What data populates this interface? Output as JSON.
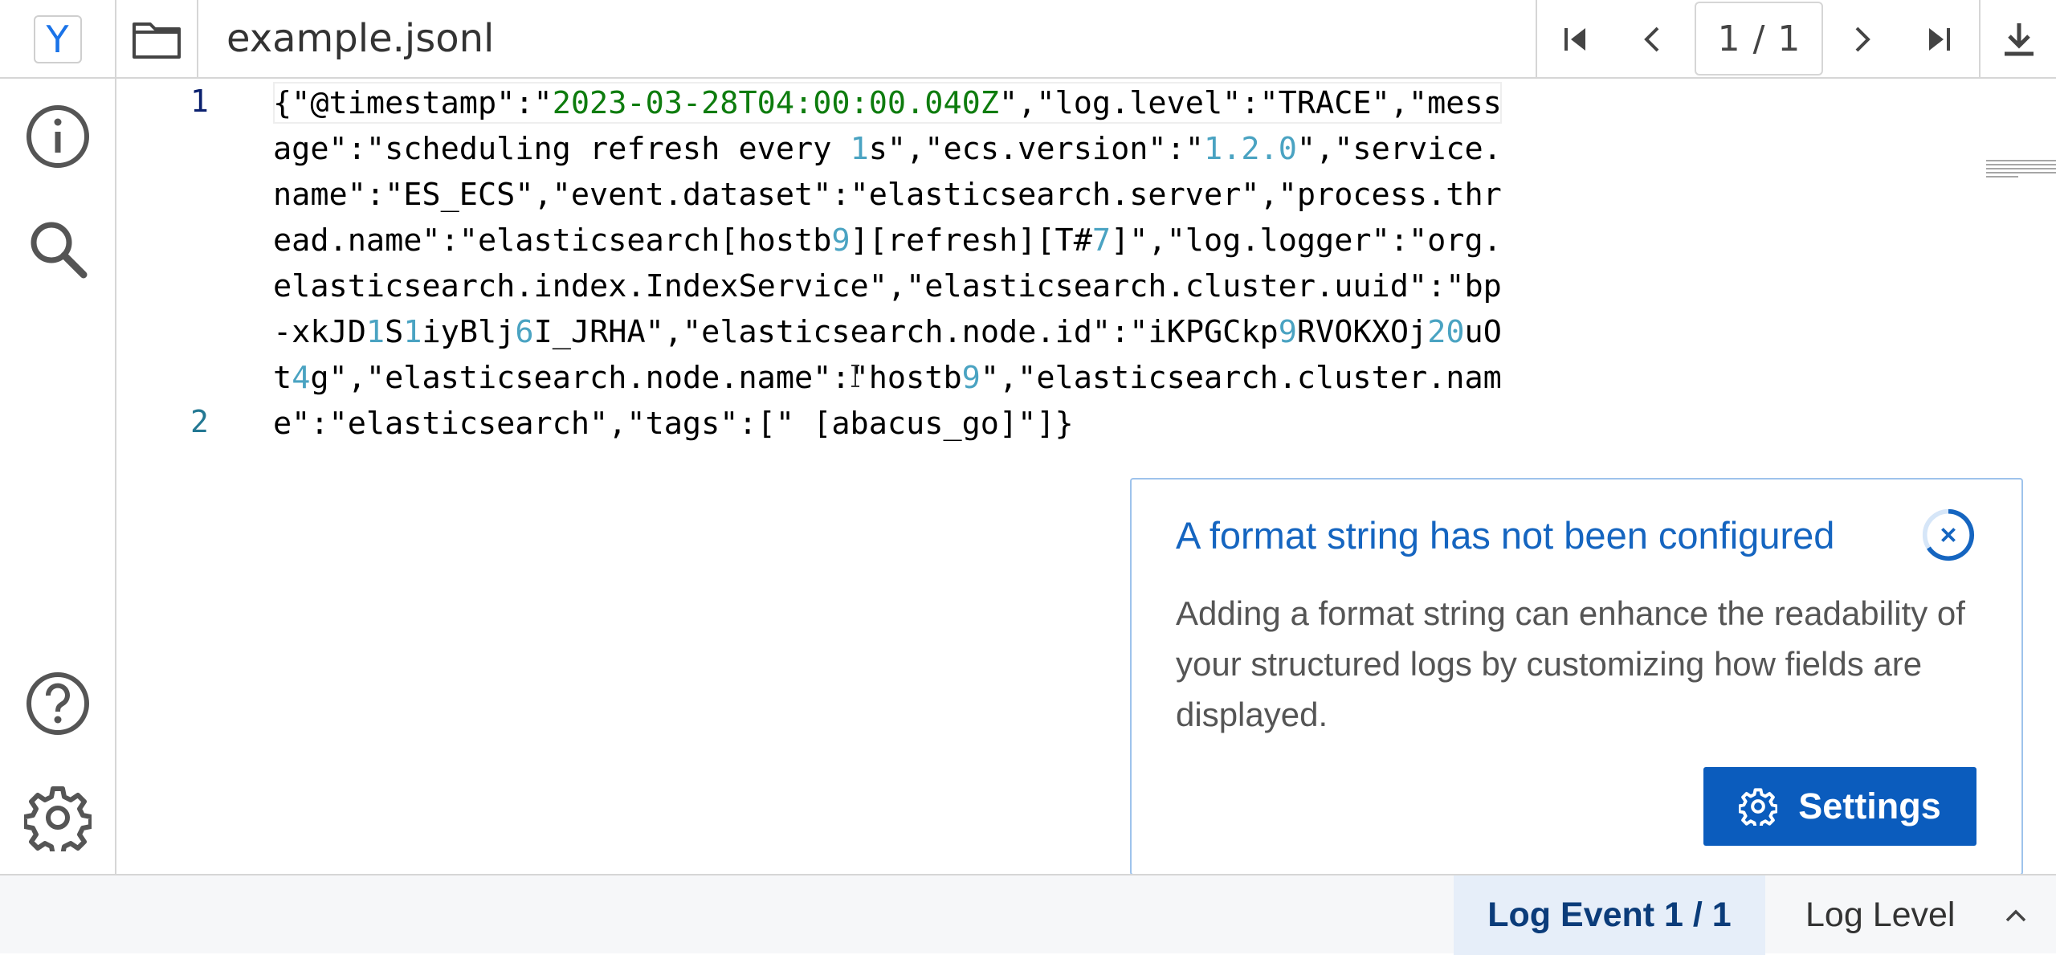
{
  "app": {
    "logo_letter": "Y",
    "filename": "example.jsonl",
    "accent": "#1a73e8"
  },
  "toolbar": {
    "page_current": "1",
    "page_sep": "/",
    "page_total": "1",
    "icons": [
      "first-page-icon",
      "prev-page-icon",
      "next-page-icon",
      "last-page-icon",
      "download-icon"
    ]
  },
  "sidebar": {
    "icons": [
      "info-icon",
      "search-icon",
      "help-icon",
      "gear-icon"
    ]
  },
  "editor": {
    "line_numbers": [
      "1",
      "2"
    ],
    "line1": {
      "p1": "{\"@timestamp\":\"",
      "ts": "2023-03-28T04:00:00.040Z",
      "p2": "\",\"log.level\":\"TRACE\",\"message\":\"scheduling refresh every ",
      "n1": "1",
      "p3": "s\",\"ecs.version\":\"",
      "n2": "1.2.0",
      "p4": "\",\"service.name\":\"ES_ECS\",\"event.dataset\":\"elasticsearch.server\",\"process.thread.name\":\"elasticsearch[hostb",
      "n3": "9",
      "p5": "][refresh][T#",
      "n4": "7",
      "p6": "]\",\"log.logger\":\"org.elasticsearch.index.IndexService\",\"elasticsearch.cluster.uuid\":\"bp-xkJD",
      "n5": "1",
      "p7": "S",
      "n6": "1",
      "p8": "iyBlj",
      "n7": "6",
      "p9": "I_JRHA\",\"elasticsearch.node.id\":\"iKPGCkp",
      "n8": "9",
      "p10": "RVOKXOj",
      "n9": "20",
      "p11": "uOt",
      "n10": "4",
      "p12": "g\",\"elasticsearch.node.name\":\"hostb",
      "n11": "9",
      "p13": "\",\"elasticsearch.cluster.name\":\"elasticsearch\",\"tags\":[\" [abacus_go]\"]}"
    }
  },
  "notification": {
    "title": "A format string has not been configured",
    "body": "Adding a format string can enhance the readability of your structured logs by customizing how fields are displayed.",
    "button_label": "Settings"
  },
  "statusbar": {
    "log_event": "Log Event 1 / 1",
    "log_level": "Log Level"
  }
}
